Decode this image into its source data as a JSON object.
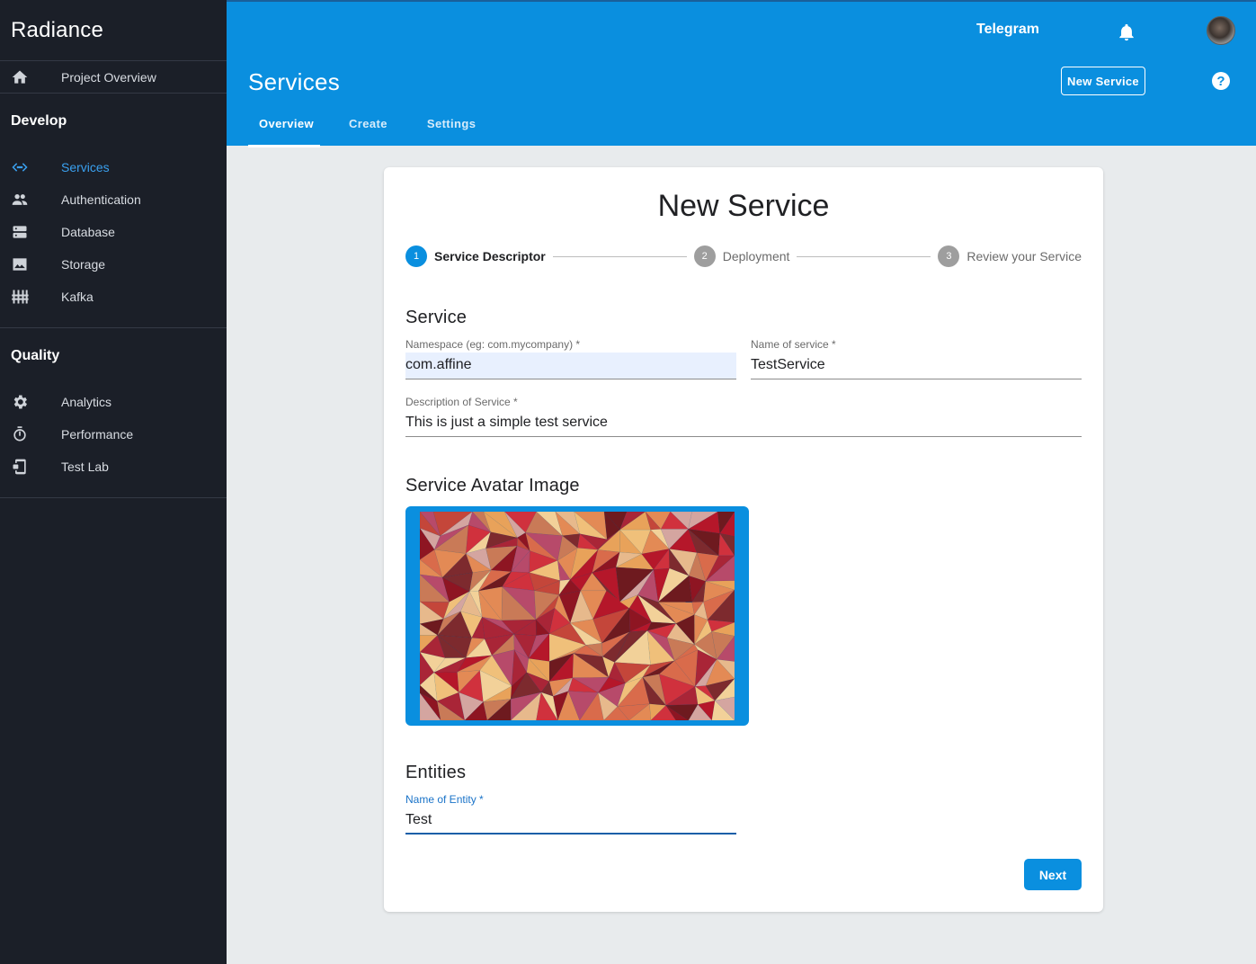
{
  "app": {
    "title": "Radiance"
  },
  "sidebar": {
    "project": {
      "label": "Project Overview",
      "icon": "home-icon"
    },
    "sections": [
      {
        "title": "Develop",
        "items": [
          {
            "label": "Services",
            "icon": "code-icon",
            "active": true
          },
          {
            "label": "Authentication",
            "icon": "people-icon"
          },
          {
            "label": "Database",
            "icon": "storage-icon"
          },
          {
            "label": "Storage",
            "icon": "image-icon"
          },
          {
            "label": "Kafka",
            "icon": "equalizer-icon"
          }
        ]
      },
      {
        "title": "Quality",
        "items": [
          {
            "label": "Analytics",
            "icon": "gear-icon"
          },
          {
            "label": "Performance",
            "icon": "timer-icon"
          },
          {
            "label": "Test Lab",
            "icon": "device-icon"
          }
        ]
      }
    ]
  },
  "header": {
    "project_name": "Telegram",
    "page_title": "Services",
    "new_service_label": "New Service",
    "help_symbol": "?",
    "tabs": [
      {
        "label": "Overview",
        "active": true
      },
      {
        "label": "Create"
      },
      {
        "label": "Settings"
      }
    ]
  },
  "card": {
    "title": "New Service",
    "steps": [
      {
        "number": "1",
        "label": "Service Descriptor",
        "active": true
      },
      {
        "number": "2",
        "label": "Deployment"
      },
      {
        "number": "3",
        "label": "Review your Service"
      }
    ],
    "service_section": {
      "heading": "Service",
      "namespace": {
        "label": "Namespace (eg: com.mycompany) *",
        "value": "com.affine"
      },
      "name": {
        "label": "Name of service *",
        "value": "TestService"
      },
      "description": {
        "label": "Description of Service *",
        "value": "This is just a simple test service"
      }
    },
    "avatar_section": {
      "heading": "Service Avatar Image"
    },
    "entities_section": {
      "heading": "Entities",
      "entity_name": {
        "label": "Name of Entity *",
        "value": "Test"
      }
    },
    "next_label": "Next"
  },
  "colors": {
    "sidebar_bg": "#1b1f28",
    "header_bg": "#0a8fdf",
    "accent": "#0a8fdf",
    "active_nav": "#3aa0ef",
    "page_bg": "#e8ebed"
  }
}
